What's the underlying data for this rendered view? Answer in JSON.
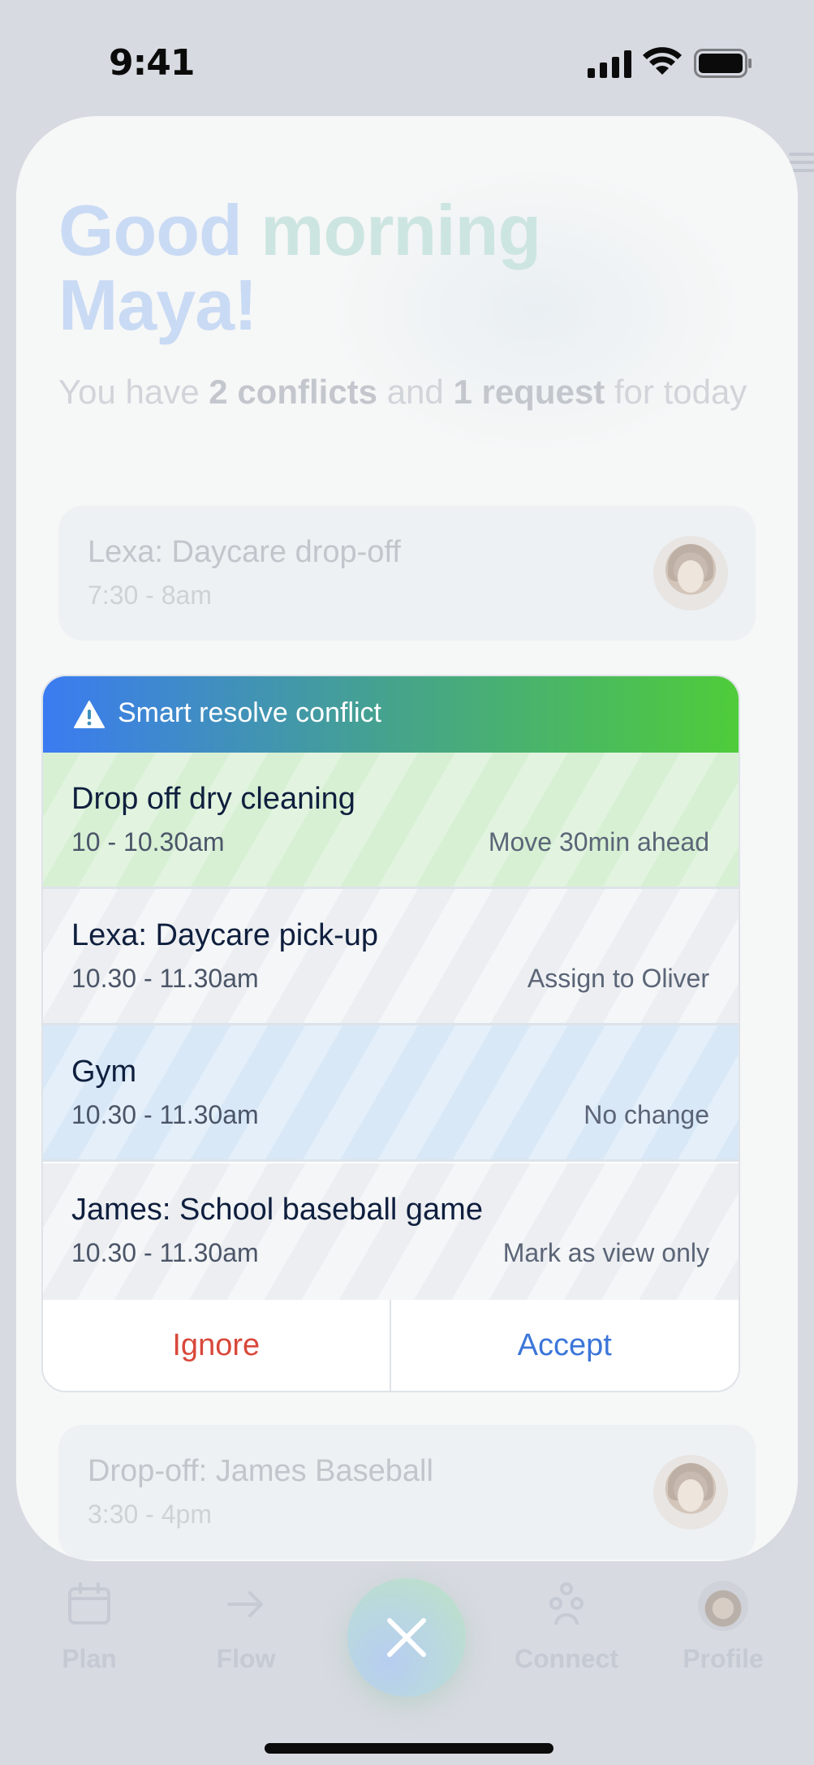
{
  "status_bar": {
    "time": "9:41"
  },
  "greeting": {
    "line1_word1": "Good",
    "line1_word2": "morning",
    "line2": "Maya!"
  },
  "summary": {
    "prefix": "You have",
    "conflicts": "2 conflicts",
    "middle": "and",
    "requests": "1 request",
    "suffix": "for today"
  },
  "top_event": {
    "title": "Lexa: Daycare drop-off",
    "time": "7:30 - 8am"
  },
  "conflict_card": {
    "title": "Smart resolve conflict",
    "rows": [
      {
        "title": "Drop off dry cleaning",
        "time": "10 - 10.30am",
        "action": "Move 30min ahead",
        "tone": "green"
      },
      {
        "title": "Lexa: Daycare pick-up",
        "time": "10.30 - 11.30am",
        "action": "Assign to Oliver",
        "tone": "gray"
      },
      {
        "title": "Gym",
        "time": "10.30 - 11.30am",
        "action": "No change",
        "tone": "blue"
      },
      {
        "title": "James: School baseball game",
        "time": "10.30 - 11.30am",
        "action": "Mark as view only",
        "tone": "gray"
      }
    ],
    "ignore_label": "Ignore",
    "accept_label": "Accept"
  },
  "bottom_event": {
    "title": "Drop-off: James Baseball",
    "time": "3:30 - 4pm"
  },
  "tabbar": {
    "tabs": [
      {
        "label": "Plan",
        "icon": "calendar-icon"
      },
      {
        "label": "Flow",
        "icon": "arrow-right-icon"
      },
      {
        "label": "Connect",
        "icon": "people-icon"
      },
      {
        "label": "Profile",
        "icon": "avatar"
      }
    ],
    "center_button_icon": "close-icon"
  },
  "colors": {
    "header_gradient_start": "#3b7bf2",
    "header_gradient_end": "#4fcc3a",
    "ignore": "#d9483b",
    "accept": "#3c76d9",
    "row_green": "#d7f0d4",
    "row_gray": "#eceef1",
    "row_blue": "#d8e8f7"
  }
}
